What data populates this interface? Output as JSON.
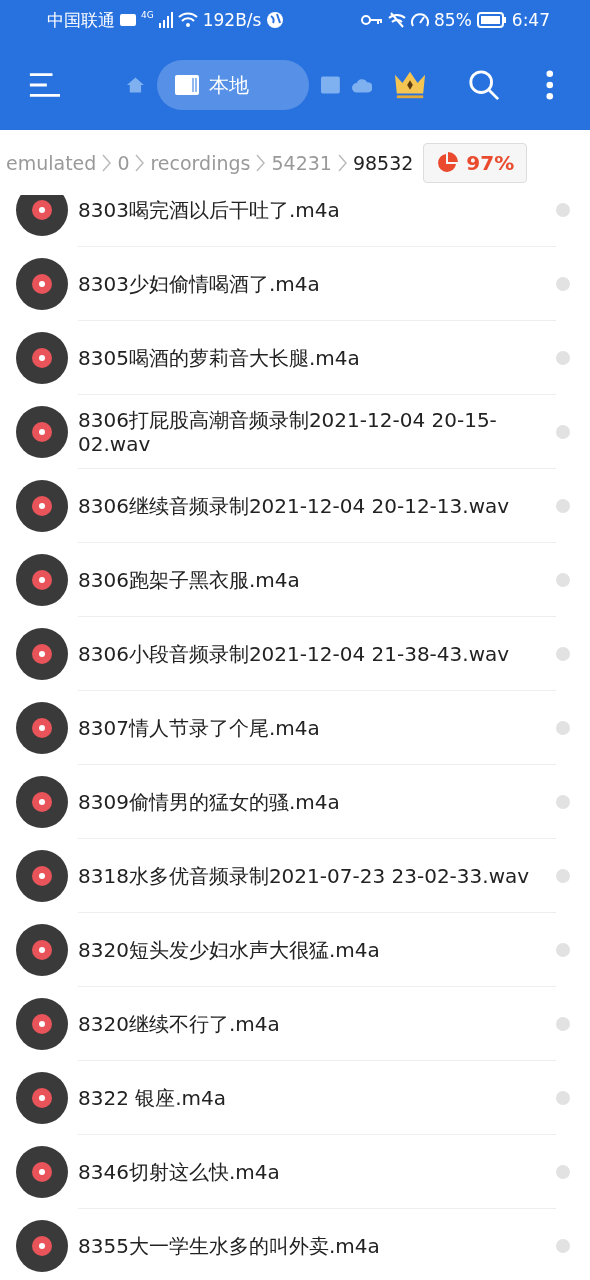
{
  "status_bar": {
    "carrier": "中国联通",
    "network": "4G",
    "speed": "192B/s",
    "battery": "85%",
    "time": "6:47"
  },
  "toolbar": {
    "location_tab": "本地"
  },
  "breadcrumb": {
    "items": [
      "emulated",
      "0",
      "recordings",
      "54231",
      "98532"
    ],
    "storage": "97%"
  },
  "files": [
    {
      "name": "8303喝完酒以后干吐了.m4a",
      "selected": false
    },
    {
      "name": "8303少妇偷情喝酒了.m4a",
      "selected": false
    },
    {
      "name": "8305喝酒的萝莉音大长腿.m4a",
      "selected": false
    },
    {
      "name": "8306打屁股高潮音频录制2021-12-04 20-15-02.wav",
      "selected": false
    },
    {
      "name": "8306继续音频录制2021-12-04 20-12-13.wav",
      "selected": false
    },
    {
      "name": "8306跑架子黑衣服.m4a",
      "selected": false
    },
    {
      "name": "8306小段音频录制2021-12-04 21-38-43.wav",
      "selected": false
    },
    {
      "name": "8307情人节录了个尾.m4a",
      "selected": false
    },
    {
      "name": "8309偷情男的猛女的骚.m4a",
      "selected": false
    },
    {
      "name": "8318水多优音频录制2021-07-23 23-02-33.wav",
      "selected": false
    },
    {
      "name": "8320短头发少妇水声大很猛.m4a",
      "selected": false
    },
    {
      "name": "8320继续不行了.m4a",
      "selected": false
    },
    {
      "name": "8322  银座.m4a",
      "selected": false
    },
    {
      "name": "8346切射这么快.m4a",
      "selected": false
    },
    {
      "name": "8355大一学生水多的叫外卖.m4a",
      "selected": false
    }
  ]
}
